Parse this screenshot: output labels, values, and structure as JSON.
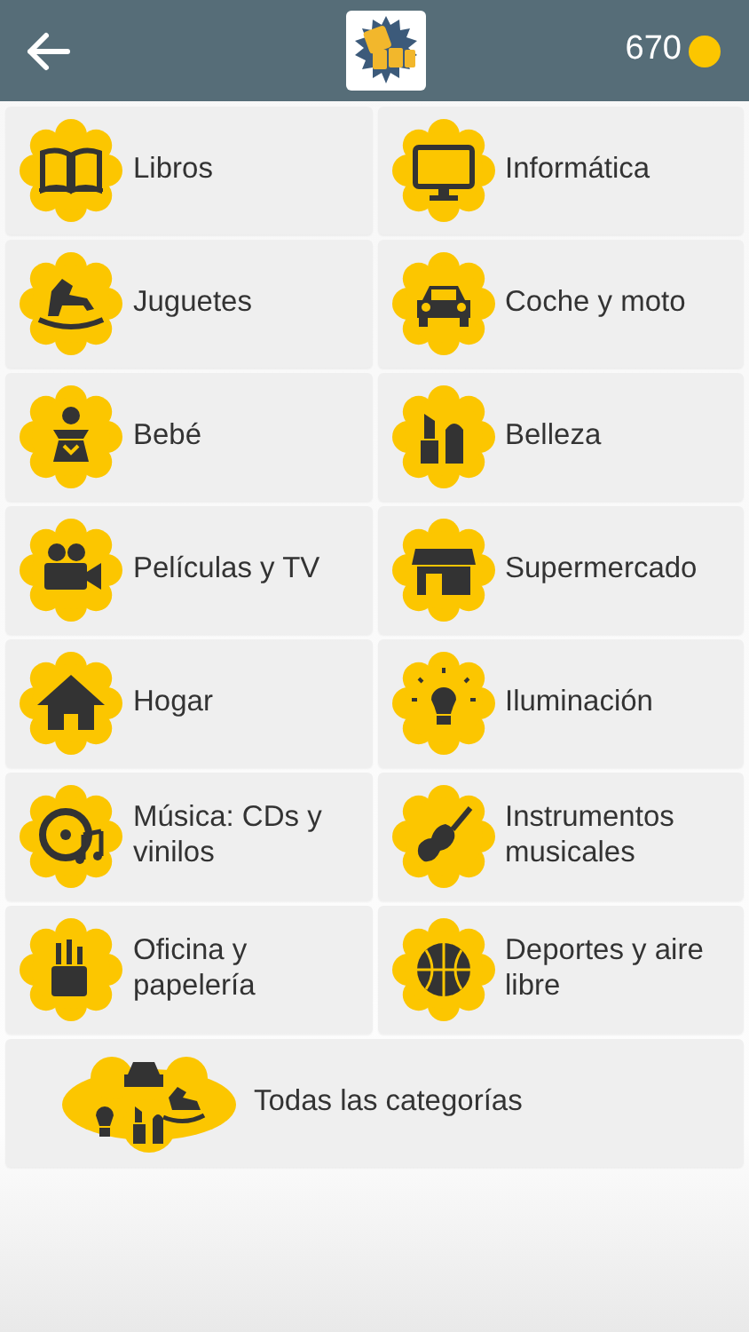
{
  "header": {
    "coins": "670"
  },
  "categories": [
    {
      "label": "Libros"
    },
    {
      "label": "Informática"
    },
    {
      "label": "Juguetes"
    },
    {
      "label": "Coche y moto"
    },
    {
      "label": "Bebé"
    },
    {
      "label": "Belleza"
    },
    {
      "label": "Películas y TV"
    },
    {
      "label": "Supermercado"
    },
    {
      "label": "Hogar"
    },
    {
      "label": "Iluminación"
    },
    {
      "label": "Música: CDs y vinilos"
    },
    {
      "label": "Instrumentos musicales"
    },
    {
      "label": "Oficina y papelería"
    },
    {
      "label": "Deportes y aire libre"
    }
  ],
  "all_categories": {
    "label": "Todas las categorías"
  }
}
